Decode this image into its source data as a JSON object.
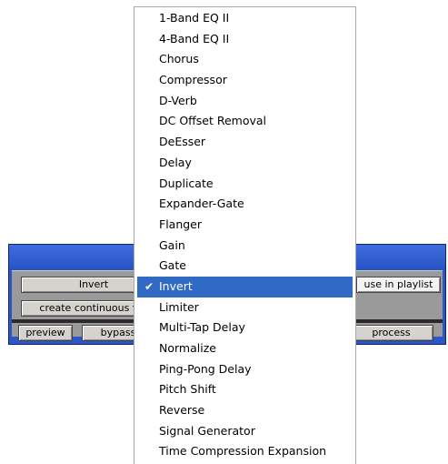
{
  "plugin": {
    "plugin_name_button": "Invert",
    "mode_button": "create continuous file",
    "playlist_button": "use in playlist",
    "preview_button": "preview",
    "bypass_button": "bypass",
    "process_button": "process"
  },
  "menu": {
    "items": [
      {
        "label": "1-Band EQ II"
      },
      {
        "label": "4-Band EQ II"
      },
      {
        "label": "Chorus"
      },
      {
        "label": "Compressor"
      },
      {
        "label": "D-Verb"
      },
      {
        "label": "DC Offset Removal"
      },
      {
        "label": "DeEsser"
      },
      {
        "label": "Delay"
      },
      {
        "label": "Duplicate"
      },
      {
        "label": "Expander-Gate"
      },
      {
        "label": "Flanger"
      },
      {
        "label": "Gain"
      },
      {
        "label": "Gate"
      },
      {
        "label": "Invert",
        "selected": true,
        "checked": true
      },
      {
        "label": "Limiter"
      },
      {
        "label": "Multi-Tap Delay"
      },
      {
        "label": "Normalize"
      },
      {
        "label": "Ping-Pong Delay"
      },
      {
        "label": "Pitch Shift"
      },
      {
        "label": "Reverse"
      },
      {
        "label": "Signal Generator"
      },
      {
        "label": "Time Compression Expansion"
      }
    ],
    "check_glyph": "✔"
  },
  "colors": {
    "selection": "#316ac5",
    "window_blue": "#2b55c8"
  }
}
